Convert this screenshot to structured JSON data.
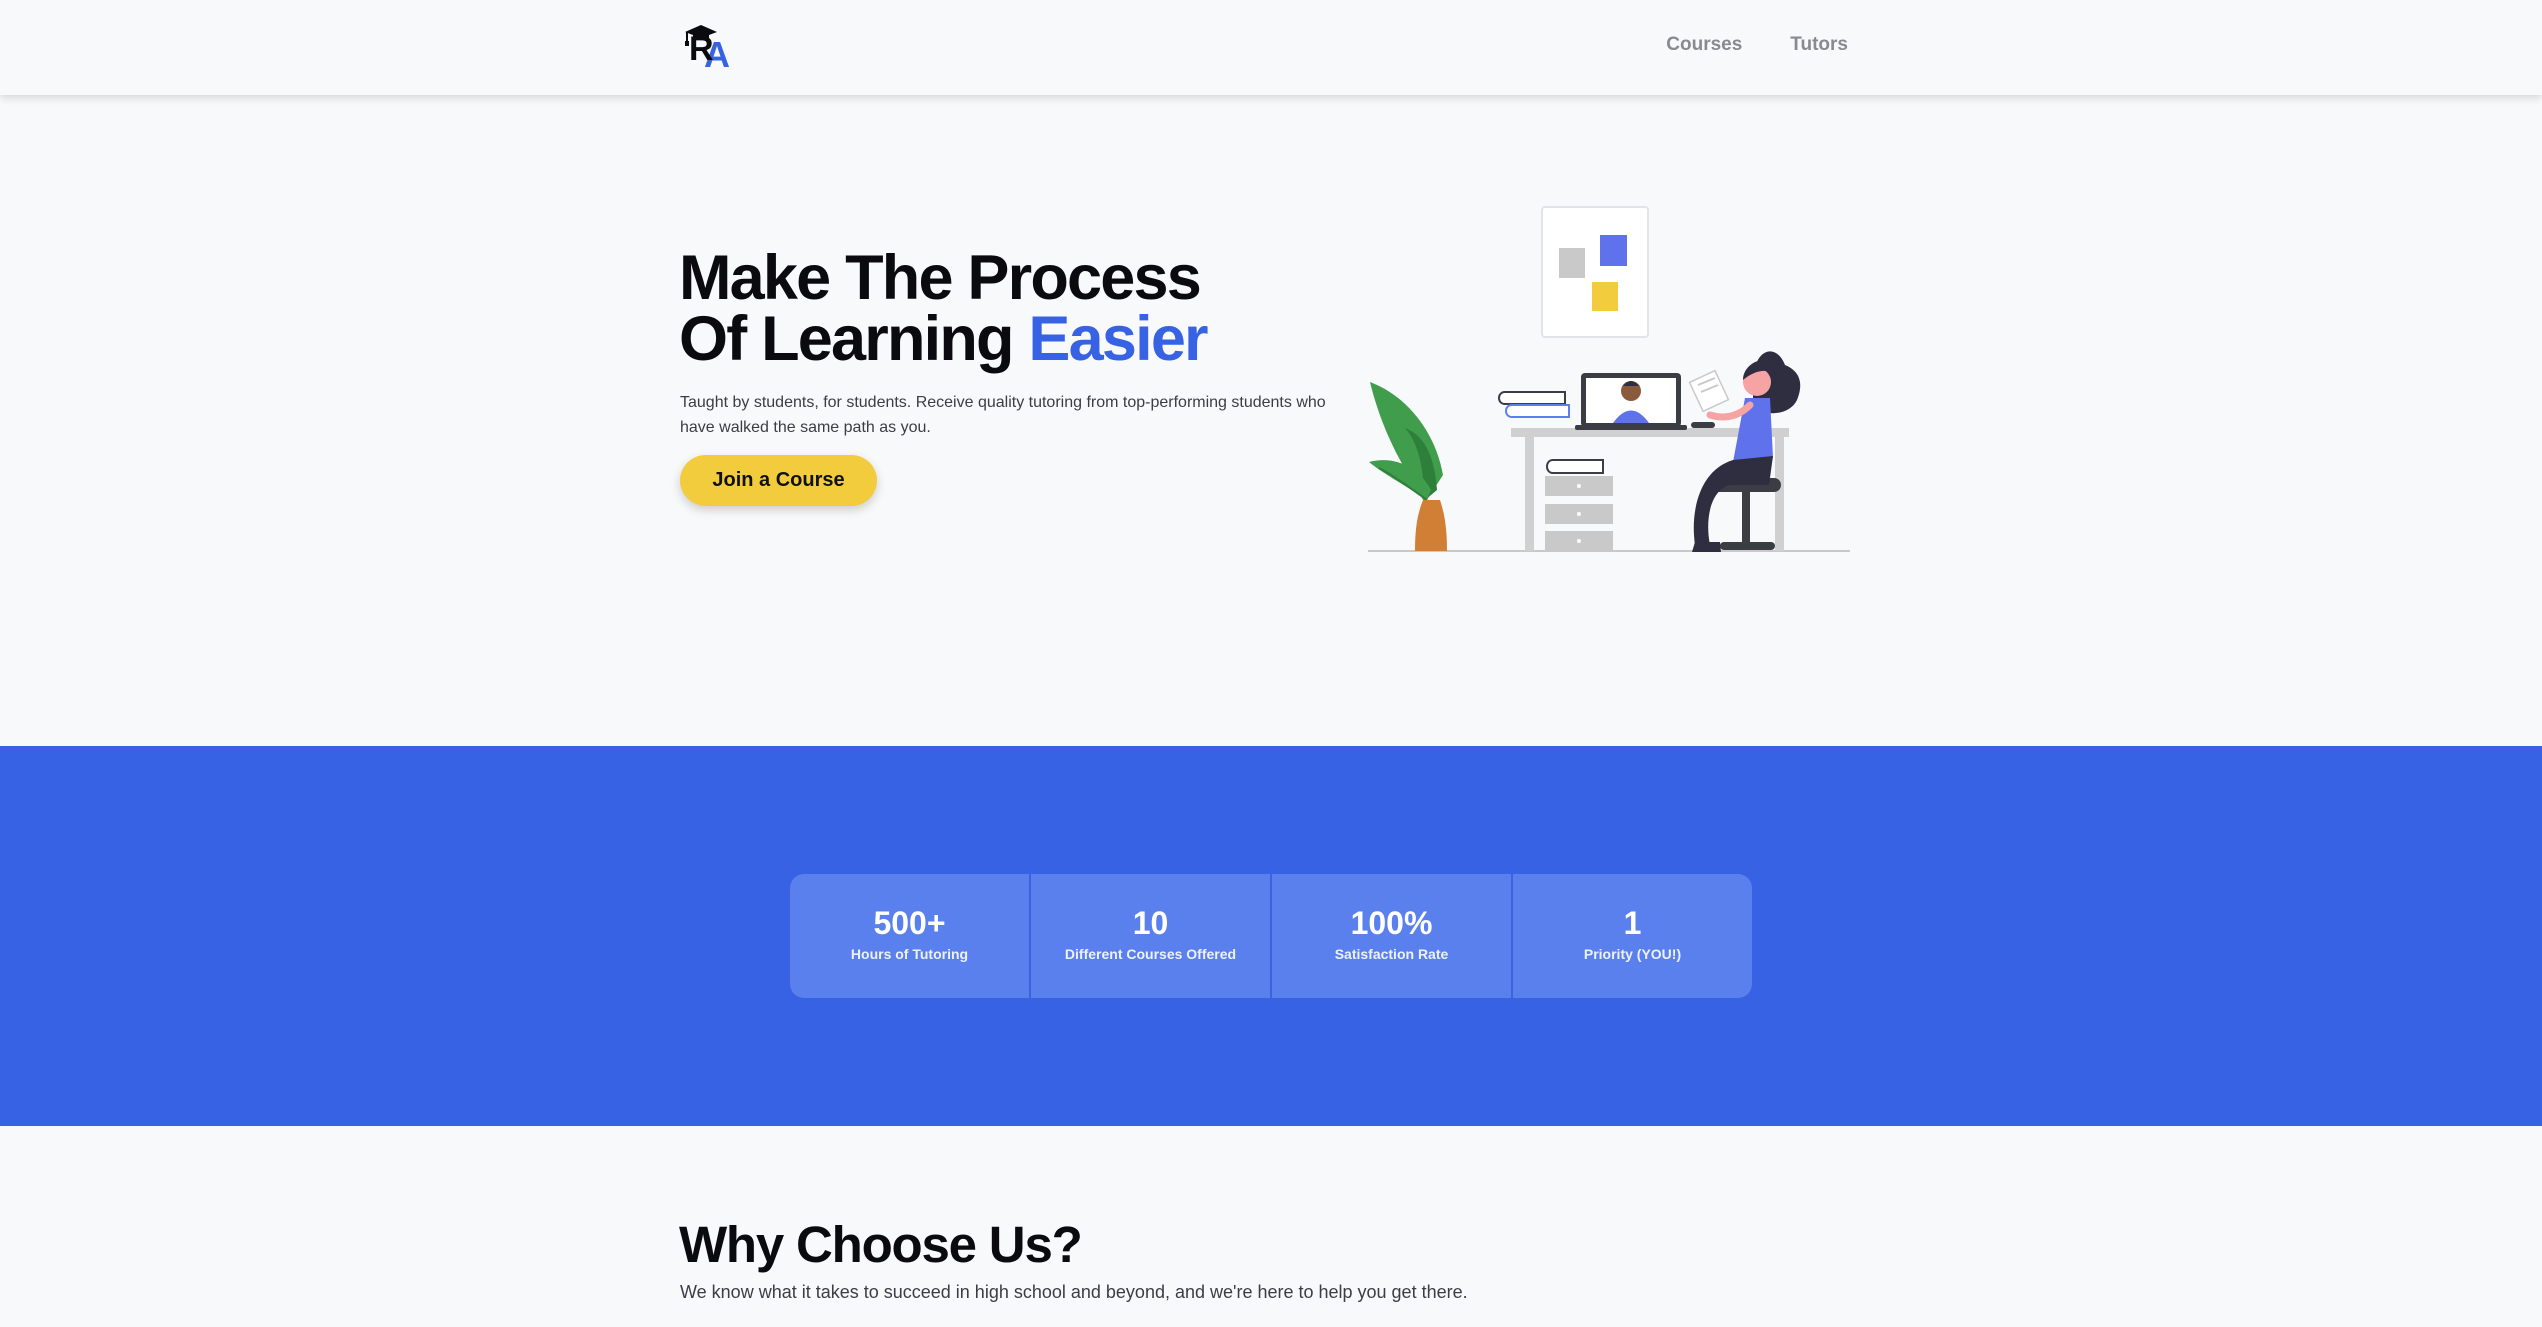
{
  "header": {
    "logo_text": "RA",
    "nav": [
      {
        "label": "Courses"
      },
      {
        "label": "Tutors"
      }
    ]
  },
  "hero": {
    "title_line1": "Make The Process",
    "title_line2_prefix": "Of Learning ",
    "title_line2_accent": "Easier",
    "description": "Taught by students, for students. Receive quality tutoring from top-performing students who have walked the same path as you.",
    "cta_label": "Join a Course"
  },
  "stats": [
    {
      "value": "500+",
      "label": "Hours of Tutoring"
    },
    {
      "value": "10",
      "label": "Different Courses Offered"
    },
    {
      "value": "100%",
      "label": "Satisfaction Rate"
    },
    {
      "value": "1",
      "label": "Priority (YOU!)"
    }
  ],
  "why": {
    "title": "Why Choose Us?",
    "description": "We know what it takes to succeed in high school and beyond, and we're here to help you get there."
  },
  "colors": {
    "accent_blue": "#3762e4",
    "stats_card": "#5a80ee",
    "cta_yellow": "#f3cc3e",
    "background": "#f8f9fb"
  },
  "icons": {
    "logo": "graduation-cap-logo-icon"
  }
}
